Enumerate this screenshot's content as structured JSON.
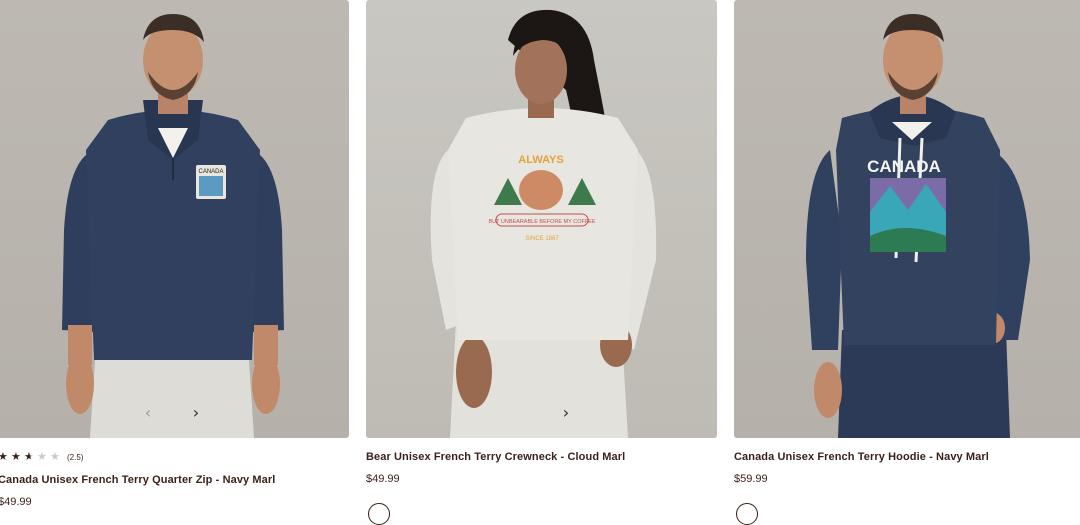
{
  "products": [
    {
      "name": "Canada Unisex French Terry Quarter Zip - Navy Marl",
      "price": "$49.99",
      "rating_count": "(2.5)",
      "rating_value": 2.5,
      "rating_max": 5,
      "image_icon": "product-photo-man-navy-quarter-zip",
      "arrow_prev": "‹",
      "arrow_next": "›"
    },
    {
      "name": "Bear Unisex French Terry Crewneck - Cloud Marl",
      "price": "$49.99",
      "image_icon": "product-photo-woman-grey-crewneck",
      "arrow_next": "›"
    },
    {
      "name": "Canada Unisex French Terry Hoodie - Navy Marl",
      "price": "$59.99",
      "image_icon": "product-photo-man-navy-hoodie"
    }
  ],
  "graphics": {
    "chest_patch_text": "CANADA",
    "hoodie_print_text": "CANADA",
    "crewneck_print_top": "ALWAYS",
    "crewneck_banner": "BUT UNBEARABLE BEFORE MY COFFEE",
    "crewneck_print_bottom": "SINCE 1867"
  },
  "colors": {
    "text": "#3a1f1a",
    "navy": "#2e3d5c",
    "cloud_marl": "#e6e5e1",
    "star_empty": "#c9c9c9"
  }
}
